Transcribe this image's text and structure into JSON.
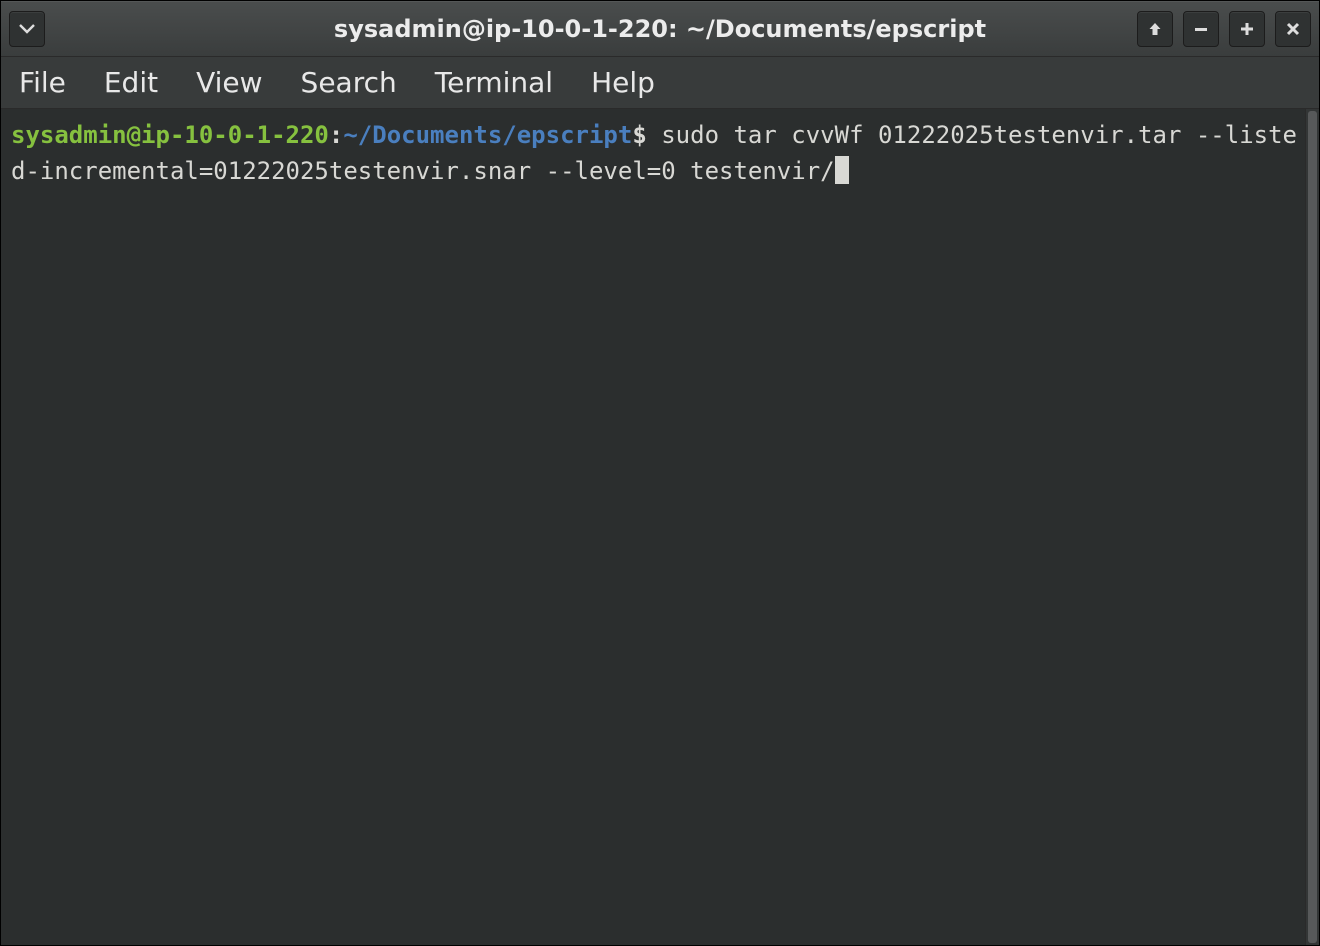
{
  "window": {
    "title": "sysadmin@ip-10-0-1-220: ~/Documents/epscript"
  },
  "menubar": {
    "items": [
      "File",
      "Edit",
      "View",
      "Search",
      "Terminal",
      "Help"
    ]
  },
  "terminal": {
    "prompt": {
      "user_host": "sysadmin@ip-10-0-1-220",
      "separator": ":",
      "path": "~/Documents/epscript",
      "end": "$"
    },
    "command": "sudo tar cvvWf 01222025testenvir.tar --listed-incremental=01222025testenvir.snar --level=0 testenvir/"
  },
  "colors": {
    "prompt_user": "#86c13f",
    "prompt_path": "#4a7fbf",
    "terminal_bg": "#2b2e2e",
    "chrome_bg": "#3b3e3e"
  }
}
